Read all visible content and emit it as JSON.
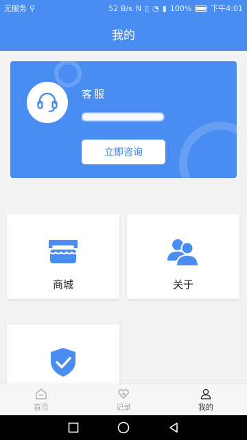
{
  "status_bar": {
    "carrier": "无服务",
    "usb_icon": "usb-icon",
    "net_speed": "52 B/s",
    "battery": "100%",
    "time": "下午4:01"
  },
  "header": {
    "title": "我的"
  },
  "service_card": {
    "title": "客服",
    "phone": "●●●●●●●●●●",
    "button_label": "立即咨询",
    "bg_color": "#4a8df2"
  },
  "tiles": [
    {
      "label": "商城",
      "icon": "store-icon"
    },
    {
      "label": "关于",
      "icon": "users-icon"
    },
    {
      "label": "",
      "icon": "shield-check-icon"
    }
  ],
  "bottom_nav": {
    "items": [
      {
        "label": "首页",
        "icon": "home-icon"
      },
      {
        "label": "记录",
        "icon": "heart-icon"
      },
      {
        "label": "我的",
        "icon": "user-icon",
        "active": true
      }
    ]
  },
  "system_nav": {
    "icons": [
      "recents-icon",
      "home-circle-icon",
      "back-icon"
    ]
  },
  "colors": {
    "accent": "#4a8df2"
  }
}
